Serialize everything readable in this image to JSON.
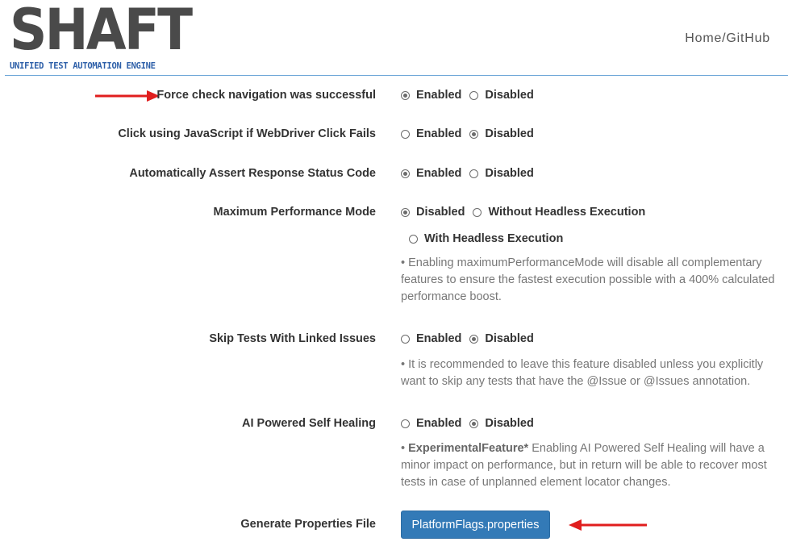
{
  "header": {
    "logo_text": "SHAFT",
    "logo_tagline": "UNIFIED TEST AUTOMATION ENGINE",
    "nav_link": "Home/GitHub"
  },
  "settings": [
    {
      "label": "Force check navigation was successful",
      "options": [
        {
          "label": "Enabled",
          "checked": true
        },
        {
          "label": "Disabled",
          "checked": false
        }
      ]
    },
    {
      "label": "Click using JavaScript if WebDriver Click Fails",
      "options": [
        {
          "label": "Enabled",
          "checked": false
        },
        {
          "label": "Disabled",
          "checked": true
        }
      ]
    },
    {
      "label": "Automatically Assert Response Status Code",
      "options": [
        {
          "label": "Enabled",
          "checked": true
        },
        {
          "label": "Disabled",
          "checked": false
        }
      ]
    },
    {
      "label": "Maximum Performance Mode",
      "options": [
        {
          "label": "Disabled",
          "checked": true
        },
        {
          "label": "Without Headless Execution",
          "checked": false
        },
        {
          "label": "With Headless Execution",
          "checked": false
        }
      ],
      "help": "• Enabling maximumPerformanceMode will disable all complementary features to ensure the fastest execution possible with a 400% calculated performance boost."
    },
    {
      "label": "Skip Tests With Linked Issues",
      "options": [
        {
          "label": "Enabled",
          "checked": false
        },
        {
          "label": "Disabled",
          "checked": true
        }
      ],
      "help": "• It is recommended to leave this feature disabled unless you explicitly want to skip any tests that have the @Issue or @Issues annotation."
    },
    {
      "label": "AI Powered Self Healing",
      "options": [
        {
          "label": "Enabled",
          "checked": false
        },
        {
          "label": "Disabled",
          "checked": true
        }
      ],
      "help_prefix": "• ",
      "help_bold": "ExperimentalFeature*",
      "help": " Enabling AI Powered Self Healing will have a minor impact on performance, but in return will be able to recover most tests in case of unplanned element locator changes."
    }
  ],
  "generate": {
    "label": "Generate Properties File",
    "button": "PlatformFlags.properties"
  },
  "colors": {
    "accent": "#337ab7",
    "arrow": "#e01e1e",
    "header_line": "#6ea6d8",
    "logo_blue": "#2d5fa8"
  },
  "icons": [
    "radio-icon",
    "arrow-right-icon",
    "arrow-left-icon"
  ]
}
